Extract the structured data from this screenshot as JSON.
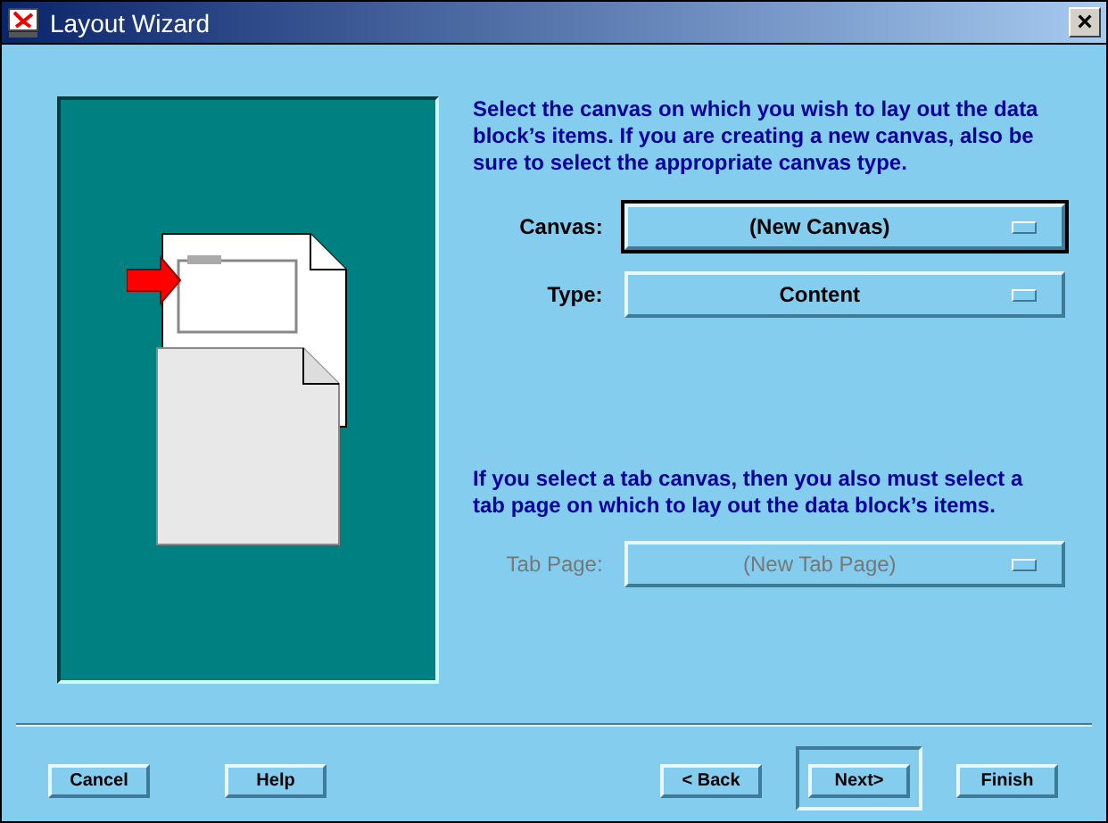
{
  "window": {
    "title": "Layout Wizard",
    "close": "×"
  },
  "instructions": "Select the canvas on which you wish to lay out the data block’s items. If you are creating a new canvas, also be sure to select the appropriate canvas type.",
  "fields": [
    {
      "label": "Canvas:",
      "value": "(New Canvas)",
      "focused": true,
      "disabled": false
    },
    {
      "label": "Type:",
      "value": "Content",
      "focused": false,
      "disabled": false
    }
  ],
  "note": "If you select a tab canvas, then you also must select a tab page on which to lay out the data block’s items.",
  "tab_field": {
    "label": "Tab Page:",
    "value": "(New Tab Page)",
    "focused": false,
    "disabled": true
  },
  "left_buttons": [
    {
      "label": "Cancel",
      "default": false
    },
    {
      "label": "Help",
      "default": false
    }
  ],
  "right_buttons": [
    {
      "label": "< Back",
      "default": false
    },
    {
      "label": "Next>",
      "default": true
    },
    {
      "label": "Finish",
      "default": false
    }
  ]
}
